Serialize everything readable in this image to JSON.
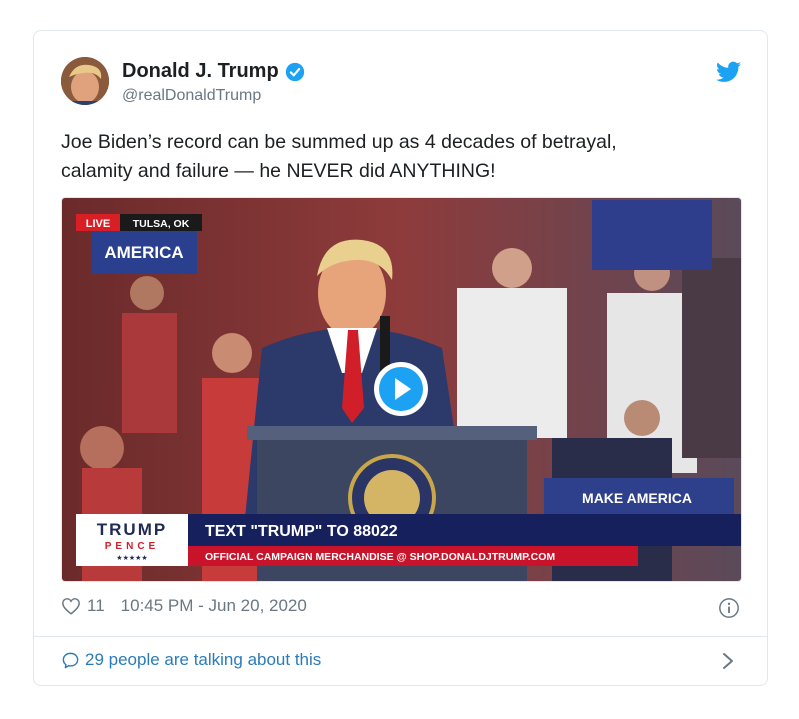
{
  "author": {
    "display_name": "Donald J. Trump",
    "handle": "@realDonaldTrump",
    "verified": true
  },
  "tweet": {
    "text_line1": "Joe Biden’s record can be summed up as 4 decades of betrayal,",
    "text_line2": "calamity and failure — he NEVER did ANYTHING!"
  },
  "video": {
    "live_badge": "LIVE",
    "location": "TULSA, OK",
    "lower_third_logo_top": "TRUMP",
    "lower_third_logo_bottom": "PENCE",
    "lower_third_stars": "★★★★★",
    "lower_third_headline": "TEXT \"TRUMP\" TO 88022",
    "lower_third_subline": "OFFICIAL CAMPAIGN MERCHANDISE @ SHOP.DONALDJTRUMP.COM",
    "background_sign_left": "AMERICA",
    "background_sign_right": "MAKE AMERICA",
    "play_icon": "play-icon"
  },
  "footer": {
    "like_count": "11",
    "timestamp": "10:45 PM - Jun 20, 2020",
    "talking": "29 people are talking about this"
  },
  "colors": {
    "link_blue": "#2b7bb9",
    "verified_blue": "#1da1f2",
    "meta_gray": "#697882",
    "text": "#1c2022"
  }
}
